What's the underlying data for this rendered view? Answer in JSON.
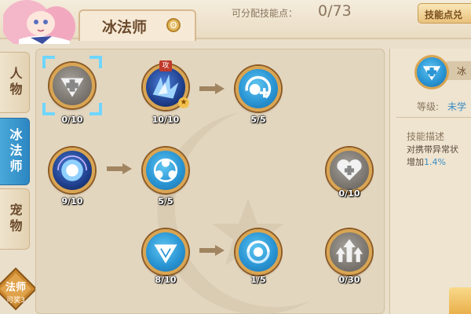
{
  "header": {
    "class_name": "冰法师",
    "points_label": "可分配技能点：",
    "points_value": "0/73",
    "reset_button": "技能点兑"
  },
  "sidebar": {
    "tabs": [
      {
        "label": "人物",
        "active": false
      },
      {
        "label": "冰法师",
        "active": true
      },
      {
        "label": "宠物",
        "active": false
      }
    ],
    "bottom_badge": {
      "title": "法师",
      "subtitle": "可奖3"
    }
  },
  "skills": [
    {
      "count": "0/10",
      "style": "grey",
      "icon": "heart-shield-plus-icon",
      "selected": true
    },
    {
      "count": "10/10",
      "style": "dark",
      "icon": "ice-blade-icon",
      "tag": "攻"
    },
    {
      "count": "5/5",
      "style": "blue",
      "icon": "orbit-plus-icon"
    },
    {
      "count": "9/10",
      "style": "dark",
      "icon": "energy-orb-icon"
    },
    {
      "count": "5/5",
      "style": "blue",
      "icon": "orb-cluster-icon"
    },
    {
      "count": "0/10",
      "style": "grey",
      "icon": "heart-plus-icon"
    },
    {
      "count": "8/10",
      "style": "blue",
      "icon": "ice-shield-icon"
    },
    {
      "count": "1/5",
      "style": "blue",
      "icon": "whirl-orb-icon"
    },
    {
      "count": "0/30",
      "style": "grey",
      "icon": "triple-arrow-up-icon"
    }
  ],
  "detail": {
    "name_partial": "冰",
    "level_label": "等级:",
    "level_value": "未学",
    "desc_title": "技能描述",
    "desc_line1": "对携带异常状",
    "desc_line2_prefix": "增加",
    "desc_line2_value": "1.4%"
  },
  "colors": {
    "accent_blue": "#2a95d4",
    "gold_border": "#d9a553",
    "highlight": "#3d8ec4"
  }
}
